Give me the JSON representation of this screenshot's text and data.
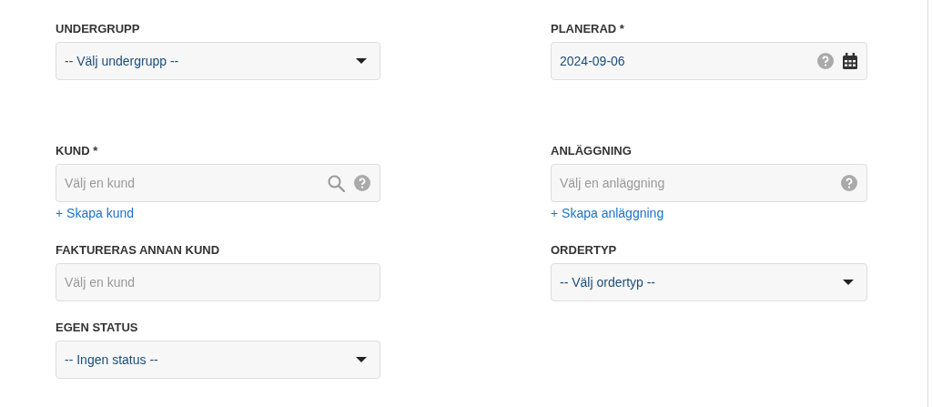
{
  "rows": [
    {
      "left": {
        "label": "UNDERGRUPP",
        "kind": "select",
        "value": "-- Välj undergrupp --"
      },
      "right": {
        "label": "PLANERAD *",
        "kind": "date",
        "value": "2024-09-06",
        "help": true
      }
    },
    {
      "left": {
        "label": "KUND *",
        "kind": "lookup",
        "placeholder": "Välj en kund",
        "search": true,
        "help": true,
        "link": "+ Skapa kund"
      },
      "right": {
        "label": "ANLÄGGNING",
        "kind": "lookup",
        "placeholder": "Välj en anläggning",
        "search": false,
        "help": true,
        "link": "+ Skapa anläggning"
      }
    },
    {
      "left": {
        "label": "FAKTURERAS ANNAN KUND",
        "kind": "lookup",
        "placeholder": "Välj en kund",
        "search": false,
        "help": false
      },
      "right": {
        "label": "ORDERTYP",
        "kind": "select",
        "value": "-- Välj ordertyp --"
      }
    },
    {
      "left": {
        "label": "EGEN STATUS",
        "kind": "select",
        "value": "-- Ingen status --"
      }
    }
  ]
}
